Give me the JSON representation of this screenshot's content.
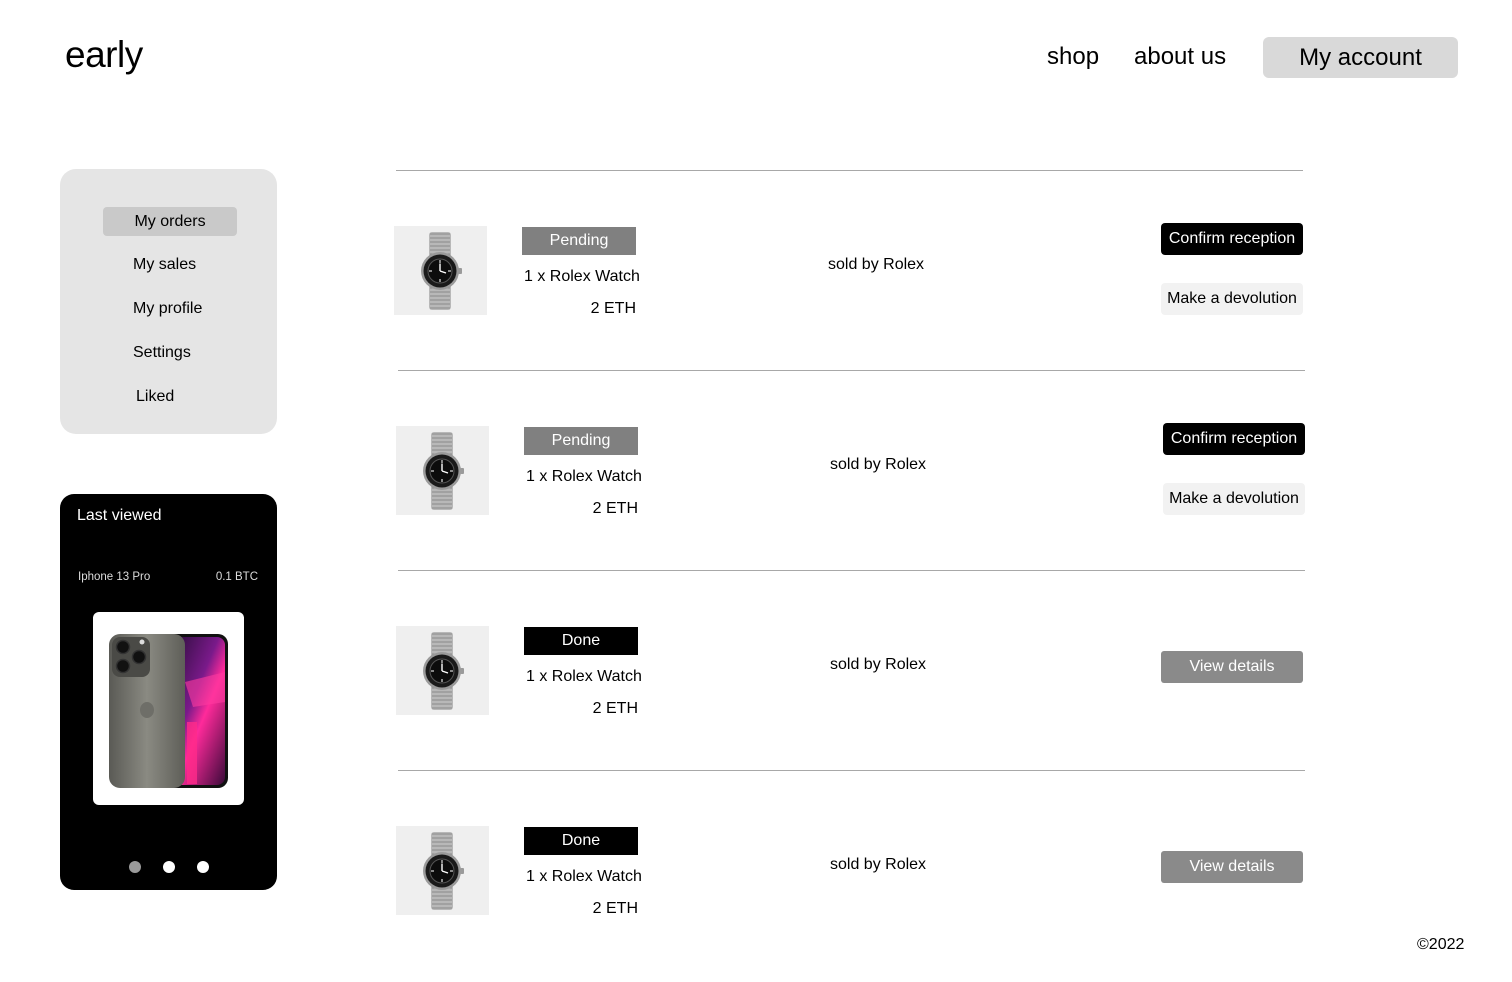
{
  "header": {
    "logo": "early",
    "nav": {
      "shop": "shop",
      "about": "about us"
    },
    "account_button": "My account"
  },
  "sidebar": {
    "items": [
      {
        "label": "My orders",
        "active": true
      },
      {
        "label": "My sales"
      },
      {
        "label": "My profile"
      },
      {
        "label": "Settings"
      },
      {
        "label": "Liked"
      }
    ]
  },
  "last_viewed": {
    "title": "Last viewed",
    "product_name": "Iphone 13 Pro",
    "product_price": "0.1 BTC",
    "carousel_dots": 3,
    "active_dot": 1
  },
  "orders": [
    {
      "status": "Pending",
      "item": "1 x Rolex Watch",
      "price": "2 ETH",
      "seller": "sold by Rolex",
      "actions": {
        "confirm": "Confirm reception",
        "devolution": "Make a devolution"
      }
    },
    {
      "status": "Pending",
      "item": "1 x Rolex Watch",
      "price": "2 ETH",
      "seller": "sold by Rolex",
      "actions": {
        "confirm": "Confirm reception",
        "devolution": "Make a devolution"
      }
    },
    {
      "status": "Done",
      "item": "1 x Rolex Watch",
      "price": "2 ETH",
      "seller": "sold by Rolex",
      "actions": {
        "details": "View details"
      }
    },
    {
      "status": "Done",
      "item": "1 x Rolex Watch",
      "price": "2 ETH",
      "seller": "sold by Rolex",
      "actions": {
        "details": "View details"
      }
    }
  ],
  "footer": {
    "copyright": "©2022"
  },
  "colors": {
    "pending": "#808080",
    "done": "#000000",
    "menu_bg": "#e5e5e5",
    "account_bg": "#d9d9d9"
  }
}
